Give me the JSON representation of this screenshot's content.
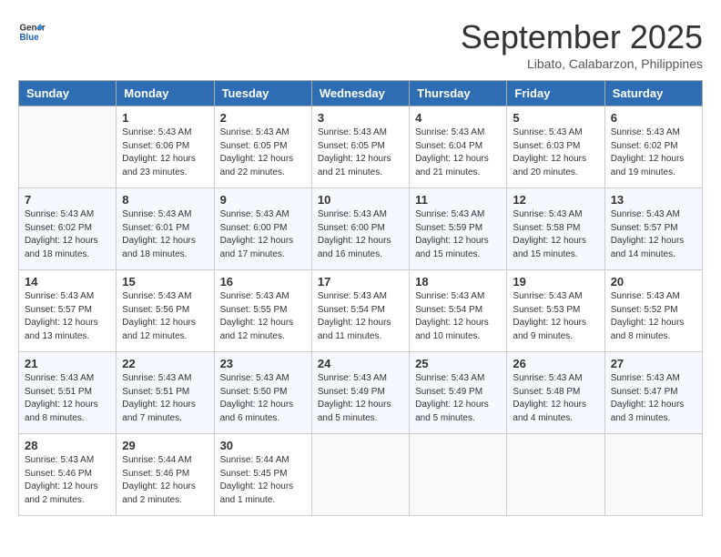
{
  "logo": {
    "line1": "General",
    "line2": "Blue"
  },
  "title": "September 2025",
  "subtitle": "Libato, Calabarzon, Philippines",
  "headers": [
    "Sunday",
    "Monday",
    "Tuesday",
    "Wednesday",
    "Thursday",
    "Friday",
    "Saturday"
  ],
  "weeks": [
    [
      {
        "day": "",
        "info": ""
      },
      {
        "day": "1",
        "info": "Sunrise: 5:43 AM\nSunset: 6:06 PM\nDaylight: 12 hours\nand 23 minutes."
      },
      {
        "day": "2",
        "info": "Sunrise: 5:43 AM\nSunset: 6:05 PM\nDaylight: 12 hours\nand 22 minutes."
      },
      {
        "day": "3",
        "info": "Sunrise: 5:43 AM\nSunset: 6:05 PM\nDaylight: 12 hours\nand 21 minutes."
      },
      {
        "day": "4",
        "info": "Sunrise: 5:43 AM\nSunset: 6:04 PM\nDaylight: 12 hours\nand 21 minutes."
      },
      {
        "day": "5",
        "info": "Sunrise: 5:43 AM\nSunset: 6:03 PM\nDaylight: 12 hours\nand 20 minutes."
      },
      {
        "day": "6",
        "info": "Sunrise: 5:43 AM\nSunset: 6:02 PM\nDaylight: 12 hours\nand 19 minutes."
      }
    ],
    [
      {
        "day": "7",
        "info": "Sunrise: 5:43 AM\nSunset: 6:02 PM\nDaylight: 12 hours\nand 18 minutes."
      },
      {
        "day": "8",
        "info": "Sunrise: 5:43 AM\nSunset: 6:01 PM\nDaylight: 12 hours\nand 18 minutes."
      },
      {
        "day": "9",
        "info": "Sunrise: 5:43 AM\nSunset: 6:00 PM\nDaylight: 12 hours\nand 17 minutes."
      },
      {
        "day": "10",
        "info": "Sunrise: 5:43 AM\nSunset: 6:00 PM\nDaylight: 12 hours\nand 16 minutes."
      },
      {
        "day": "11",
        "info": "Sunrise: 5:43 AM\nSunset: 5:59 PM\nDaylight: 12 hours\nand 15 minutes."
      },
      {
        "day": "12",
        "info": "Sunrise: 5:43 AM\nSunset: 5:58 PM\nDaylight: 12 hours\nand 15 minutes."
      },
      {
        "day": "13",
        "info": "Sunrise: 5:43 AM\nSunset: 5:57 PM\nDaylight: 12 hours\nand 14 minutes."
      }
    ],
    [
      {
        "day": "14",
        "info": "Sunrise: 5:43 AM\nSunset: 5:57 PM\nDaylight: 12 hours\nand 13 minutes."
      },
      {
        "day": "15",
        "info": "Sunrise: 5:43 AM\nSunset: 5:56 PM\nDaylight: 12 hours\nand 12 minutes."
      },
      {
        "day": "16",
        "info": "Sunrise: 5:43 AM\nSunset: 5:55 PM\nDaylight: 12 hours\nand 12 minutes."
      },
      {
        "day": "17",
        "info": "Sunrise: 5:43 AM\nSunset: 5:54 PM\nDaylight: 12 hours\nand 11 minutes."
      },
      {
        "day": "18",
        "info": "Sunrise: 5:43 AM\nSunset: 5:54 PM\nDaylight: 12 hours\nand 10 minutes."
      },
      {
        "day": "19",
        "info": "Sunrise: 5:43 AM\nSunset: 5:53 PM\nDaylight: 12 hours\nand 9 minutes."
      },
      {
        "day": "20",
        "info": "Sunrise: 5:43 AM\nSunset: 5:52 PM\nDaylight: 12 hours\nand 8 minutes."
      }
    ],
    [
      {
        "day": "21",
        "info": "Sunrise: 5:43 AM\nSunset: 5:51 PM\nDaylight: 12 hours\nand 8 minutes."
      },
      {
        "day": "22",
        "info": "Sunrise: 5:43 AM\nSunset: 5:51 PM\nDaylight: 12 hours\nand 7 minutes."
      },
      {
        "day": "23",
        "info": "Sunrise: 5:43 AM\nSunset: 5:50 PM\nDaylight: 12 hours\nand 6 minutes."
      },
      {
        "day": "24",
        "info": "Sunrise: 5:43 AM\nSunset: 5:49 PM\nDaylight: 12 hours\nand 5 minutes."
      },
      {
        "day": "25",
        "info": "Sunrise: 5:43 AM\nSunset: 5:49 PM\nDaylight: 12 hours\nand 5 minutes."
      },
      {
        "day": "26",
        "info": "Sunrise: 5:43 AM\nSunset: 5:48 PM\nDaylight: 12 hours\nand 4 minutes."
      },
      {
        "day": "27",
        "info": "Sunrise: 5:43 AM\nSunset: 5:47 PM\nDaylight: 12 hours\nand 3 minutes."
      }
    ],
    [
      {
        "day": "28",
        "info": "Sunrise: 5:43 AM\nSunset: 5:46 PM\nDaylight: 12 hours\nand 2 minutes."
      },
      {
        "day": "29",
        "info": "Sunrise: 5:44 AM\nSunset: 5:46 PM\nDaylight: 12 hours\nand 2 minutes."
      },
      {
        "day": "30",
        "info": "Sunrise: 5:44 AM\nSunset: 5:45 PM\nDaylight: 12 hours\nand 1 minute."
      },
      {
        "day": "",
        "info": ""
      },
      {
        "day": "",
        "info": ""
      },
      {
        "day": "",
        "info": ""
      },
      {
        "day": "",
        "info": ""
      }
    ]
  ]
}
